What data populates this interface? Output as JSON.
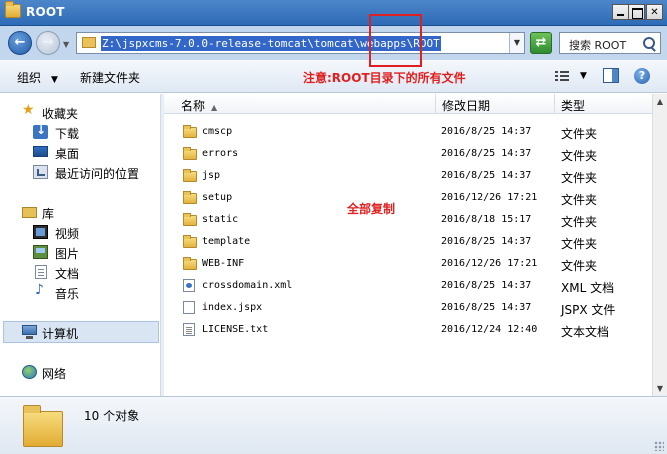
{
  "window": {
    "title": "ROOT"
  },
  "address": {
    "path": "Z:\\jspxcms-7.0.0-release-tomcat\\tomcat\\webapps\\ROOT",
    "search_placeholder": "搜索 ROOT"
  },
  "toolbar": {
    "organize_label": "组织",
    "new_folder_label": "新建文件夹",
    "annotation": "注意:ROOT目录下的所有文件"
  },
  "sidebar": {
    "favorites": {
      "label": "收藏夹",
      "items": [
        "下载",
        "桌面",
        "最近访问的位置"
      ]
    },
    "libraries": {
      "label": "库",
      "items": [
        "视频",
        "图片",
        "文档",
        "音乐"
      ]
    },
    "computer": "计算机",
    "network": "网络"
  },
  "columns": {
    "name": "名称",
    "date": "修改日期",
    "type": "类型"
  },
  "files": [
    {
      "name": "cmscp",
      "date": "2016/8/25 14:37",
      "type": "文件夹",
      "icon": "folder-icon"
    },
    {
      "name": "errors",
      "date": "2016/8/25 14:37",
      "type": "文件夹",
      "icon": "folder-icon"
    },
    {
      "name": "jsp",
      "date": "2016/8/25 14:37",
      "type": "文件夹",
      "icon": "folder-icon"
    },
    {
      "name": "setup",
      "date": "2016/12/26 17:21",
      "type": "文件夹",
      "icon": "folder-icon"
    },
    {
      "name": "static",
      "date": "2016/8/18 15:17",
      "type": "文件夹",
      "icon": "folder-icon"
    },
    {
      "name": "template",
      "date": "2016/8/25 14:37",
      "type": "文件夹",
      "icon": "folder-icon"
    },
    {
      "name": "WEB-INF",
      "date": "2016/12/26 17:21",
      "type": "文件夹",
      "icon": "folder-icon"
    },
    {
      "name": "crossdomain.xml",
      "date": "2016/8/25 14:37",
      "type": "XML 文档",
      "icon": "xml-file-icon"
    },
    {
      "name": "index.jspx",
      "date": "2016/8/25 14:37",
      "type": "JSPX 文件",
      "icon": "file-icon"
    },
    {
      "name": "LICENSE.txt",
      "date": "2016/12/24 12:40",
      "type": "文本文档",
      "icon": "text-file-icon"
    }
  ],
  "list_annotation": "全部复制",
  "status": {
    "count": "10 个对象"
  },
  "colors": {
    "annotation_red": "#e01f1f",
    "titlebar_blue": "#2e6bb7",
    "path_highlight": "#3266c8"
  }
}
